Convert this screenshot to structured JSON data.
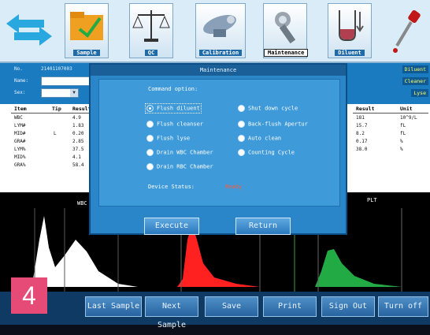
{
  "toolbar": {
    "buttons": [
      {
        "label": "",
        "icon": "swap-arrows-icon"
      },
      {
        "label": "Sample",
        "icon": "folder-icon"
      },
      {
        "label": "QC",
        "icon": "balance-scale-icon"
      },
      {
        "label": "Calibration",
        "icon": "microscope-icon"
      },
      {
        "label": "Maintenance",
        "icon": "wrench-icon",
        "active": true
      },
      {
        "label": "Diluent",
        "icon": "diluent-bottle-icon"
      },
      {
        "label": "",
        "icon": "dropper-icon"
      }
    ]
  },
  "info": {
    "no_label": "No.",
    "no_value": "21401107003",
    "name_label": "Name:",
    "sex_label": "Sex:",
    "right_tags": [
      "Diluent",
      "Cleaner",
      "Lyse"
    ]
  },
  "table": {
    "left_headers": [
      "Item",
      "Tip",
      "Result"
    ],
    "rows": [
      {
        "item": "WBC",
        "tip": "",
        "value": "4.9"
      },
      {
        "item": "LYM#",
        "tip": "",
        "value": "1.83"
      },
      {
        "item": "MID#",
        "tip": "L",
        "value": "0.20"
      },
      {
        "item": "GRA#",
        "tip": "",
        "value": "2.85"
      },
      {
        "item": "LYM%",
        "tip": "",
        "value": "37.5"
      },
      {
        "item": "MID%",
        "tip": "",
        "value": "4.1"
      },
      {
        "item": "GRA%",
        "tip": "",
        "value": "58.4"
      }
    ],
    "right_headers": [
      "Result",
      "Unit"
    ],
    "right_rows": [
      {
        "value": "181",
        "unit": "10^9/L"
      },
      {
        "value": "15.7",
        "unit": "fL"
      },
      {
        "value": "8.2",
        "unit": "fL"
      },
      {
        "value": "0.17",
        "unit": "%"
      },
      {
        "value": "38.0",
        "unit": "%"
      }
    ]
  },
  "histograms": {
    "wbc_label": "WBC",
    "plt_label": "PLT",
    "colors": {
      "wbc": "#ffffff",
      "rbc": "#ff2020",
      "plt": "#22aa44"
    }
  },
  "dialog": {
    "title": "Maintenance",
    "heading": "Command option:",
    "options_left": [
      "Flush diluent",
      "Flush cleanser",
      "Flush lyse",
      "Drain WBC Chamber",
      "Drain RBC Chamber"
    ],
    "options_right": [
      "Shut down cycle",
      "Back-flush Apertur",
      "Auto clean",
      "Counting Cycle"
    ],
    "selected": "Flush diluent",
    "status_label": "Device Status:",
    "status_value": "Ready",
    "execute_label": "Execute",
    "return_label": "Return"
  },
  "footer": {
    "badge": "4",
    "buttons": [
      "Last Sample",
      "Next Sample",
      "Save",
      "Print",
      "Sign Out",
      "Turn off"
    ]
  }
}
